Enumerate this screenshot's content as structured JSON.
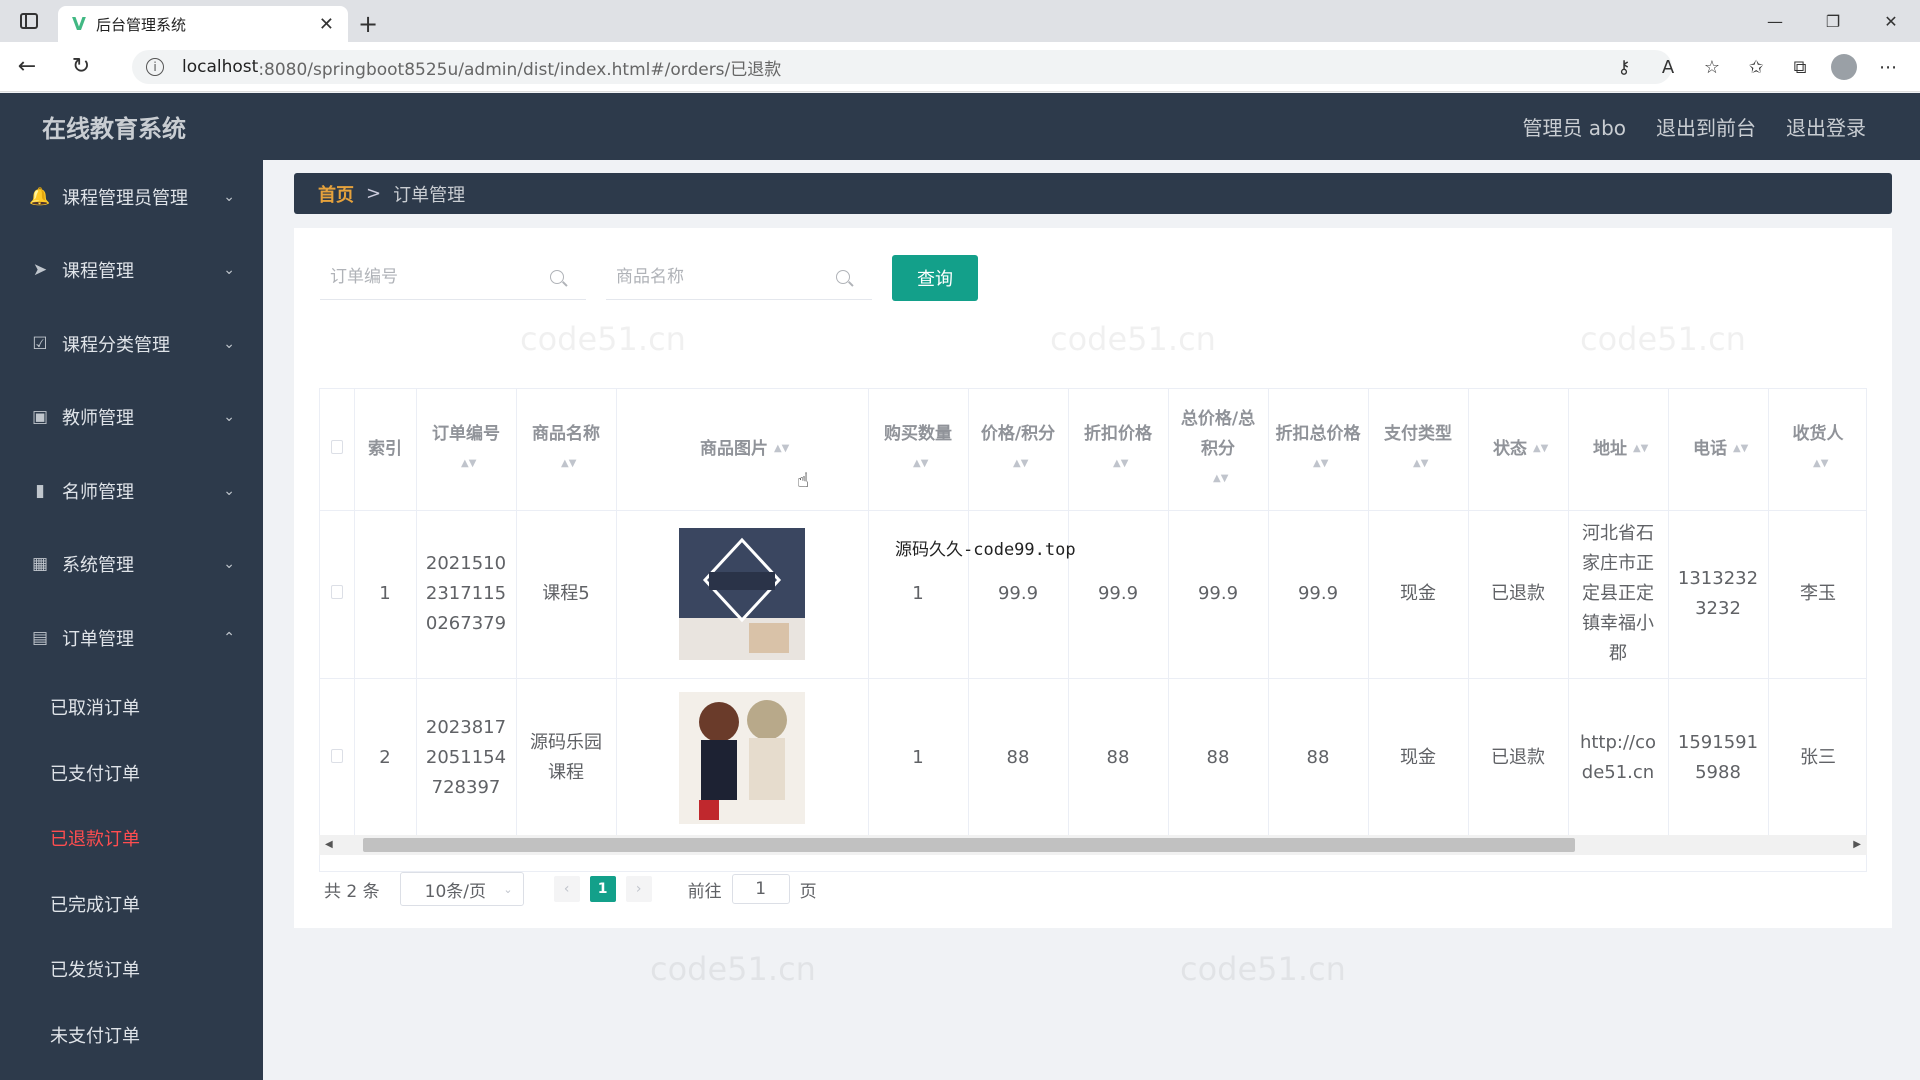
{
  "browser": {
    "tab_title": "后台管理系统",
    "url_host": "localhost",
    "url_path": ":8080/springboot8525u/admin/dist/index.html#/orders/已退款"
  },
  "header": {
    "brand": "在线教育系统",
    "links": [
      "管理员 abo",
      "退出到前台",
      "退出登录"
    ]
  },
  "sidebar": {
    "items": [
      {
        "label": "课程管理员管理",
        "icon": "bell-icon",
        "glyph": "🔔"
      },
      {
        "label": "课程管理",
        "icon": "send-icon",
        "glyph": "➤"
      },
      {
        "label": "课程分类管理",
        "icon": "checkbox-icon",
        "glyph": "☑"
      },
      {
        "label": "教师管理",
        "icon": "chat-icon",
        "glyph": "▣"
      },
      {
        "label": "名师管理",
        "icon": "bar-chart-icon",
        "glyph": "▮"
      },
      {
        "label": "系统管理",
        "icon": "line-chart-icon",
        "glyph": "▦"
      },
      {
        "label": "订单管理",
        "icon": "order-icon",
        "glyph": "▤"
      }
    ],
    "order_sub": [
      "已取消订单",
      "已支付订单",
      "已退款订单",
      "已完成订单",
      "已发货订单",
      "未支付订单"
    ],
    "active_sub": "已退款订单"
  },
  "breadcrumb": {
    "home": "首页",
    "sep": ">",
    "current": "订单管理"
  },
  "search": {
    "order_no_placeholder": "订单编号",
    "product_placeholder": "商品名称",
    "query_label": "查询"
  },
  "table": {
    "headers": [
      "索引",
      "订单编号",
      "商品名称",
      "商品图片",
      "购买数量",
      "价格/积分",
      "折扣价格",
      "总价格/总积分",
      "折扣总价格",
      "支付类型",
      "状态",
      "地址",
      "电话",
      "收货人"
    ],
    "rows": [
      {
        "index": "1",
        "order_no": "20215102317115 0267379",
        "product": "课程5",
        "qty": "1",
        "price": "99.9",
        "discount": "99.9",
        "total": "99.9",
        "discount_total": "99.9",
        "pay": "现金",
        "status": "已退款",
        "address": "河北省石家庄市正定县正定镇幸福小郡",
        "phone": "13132323232",
        "receiver": "李玉"
      },
      {
        "index": "2",
        "order_no": "20238172051154 728397",
        "product": "源码乐园课程",
        "qty": "1",
        "price": "88",
        "discount": "88",
        "total": "88",
        "discount_total": "88",
        "pay": "现金",
        "status": "已退款",
        "address": "http://code51.cn",
        "phone": "15915915988",
        "receiver": "张三"
      }
    ],
    "overlay_text": "源码久久-code99.top"
  },
  "pager": {
    "total": "共 2 条",
    "size": "10条/页",
    "current_page": "1",
    "goto": "前往",
    "goto_value": "1",
    "page_unit": "页"
  },
  "watermark": "code51.cn"
}
